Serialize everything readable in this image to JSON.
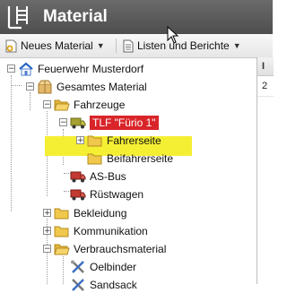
{
  "header": {
    "title": "Material",
    "icon": "ladder-icon"
  },
  "toolbar": {
    "new_material": {
      "label": "Neues Material",
      "icon": "add-document-icon"
    },
    "lists_reports": {
      "label": "Listen und Berichte",
      "icon": "document-list-icon"
    }
  },
  "right_panel": {
    "col_header": "I",
    "cell": "2"
  },
  "tree": {
    "root": "Feuerwehr Musterdorf",
    "gesamtes": "Gesamtes Material",
    "fahrzeuge": "Fahrzeuge",
    "tlf": "TLF \"Fürio 1\"",
    "fahrerseite": "Fahrerseite",
    "beifahrerseite": "Beifahrerseite",
    "as_bus": "AS-Bus",
    "ruestwagen": "Rüstwagen",
    "bekleidung": "Bekleidung",
    "kommunikation": "Kommunikation",
    "verbrauchsmaterial": "Verbrauchsmaterial",
    "oelbinder": "Oelbinder",
    "sandsack": "Sandsack"
  },
  "colors": {
    "header_bg": "#555555",
    "selected_bg": "#d9252a",
    "highlight": "#f4ef33",
    "folder": "#f2c94c"
  }
}
